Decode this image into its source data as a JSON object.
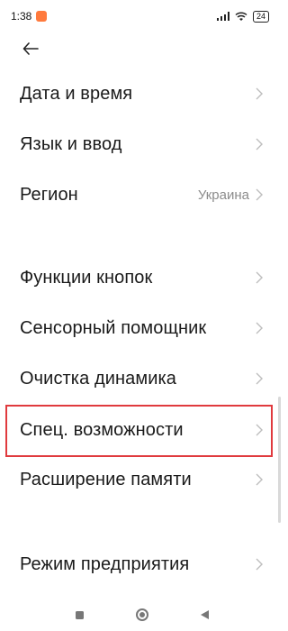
{
  "status_bar": {
    "time": "1:38",
    "battery": "24"
  },
  "settings": {
    "items": [
      {
        "label": "Дата и время",
        "value": ""
      },
      {
        "label": "Язык и ввод",
        "value": ""
      },
      {
        "label": "Регион",
        "value": "Украина"
      },
      {
        "label": "Функции кнопок",
        "value": ""
      },
      {
        "label": "Сенсорный помощник",
        "value": ""
      },
      {
        "label": "Очистка динамика",
        "value": ""
      },
      {
        "label": "Спец. возможности",
        "value": ""
      },
      {
        "label": "Расширение памяти",
        "value": ""
      },
      {
        "label": "Режим предприятия",
        "value": ""
      }
    ]
  },
  "icons": {
    "back": "back-arrow-icon",
    "chevron": "chevron-right-icon",
    "wifi": "wifi-icon",
    "signal": "signal-icon",
    "battery": "battery-icon"
  },
  "colors": {
    "highlight": "#e03a3e",
    "label": "#1a1a1a",
    "secondary": "#8c8c8c"
  }
}
